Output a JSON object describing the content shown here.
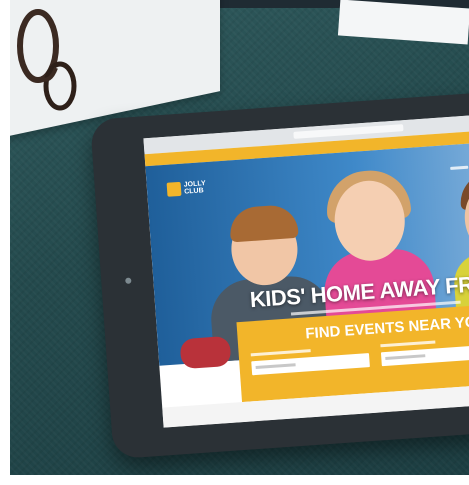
{
  "website": {
    "logo_text": "JOLLY CLUB",
    "headline": "KIDS' HOME AWAY FROM",
    "events_title": "FIND EVENTS NEAR YO"
  },
  "colors": {
    "accent_yellow": "#f2b52a",
    "hero_blue": "#2f75b5",
    "carpet_teal": "#2a5457"
  }
}
